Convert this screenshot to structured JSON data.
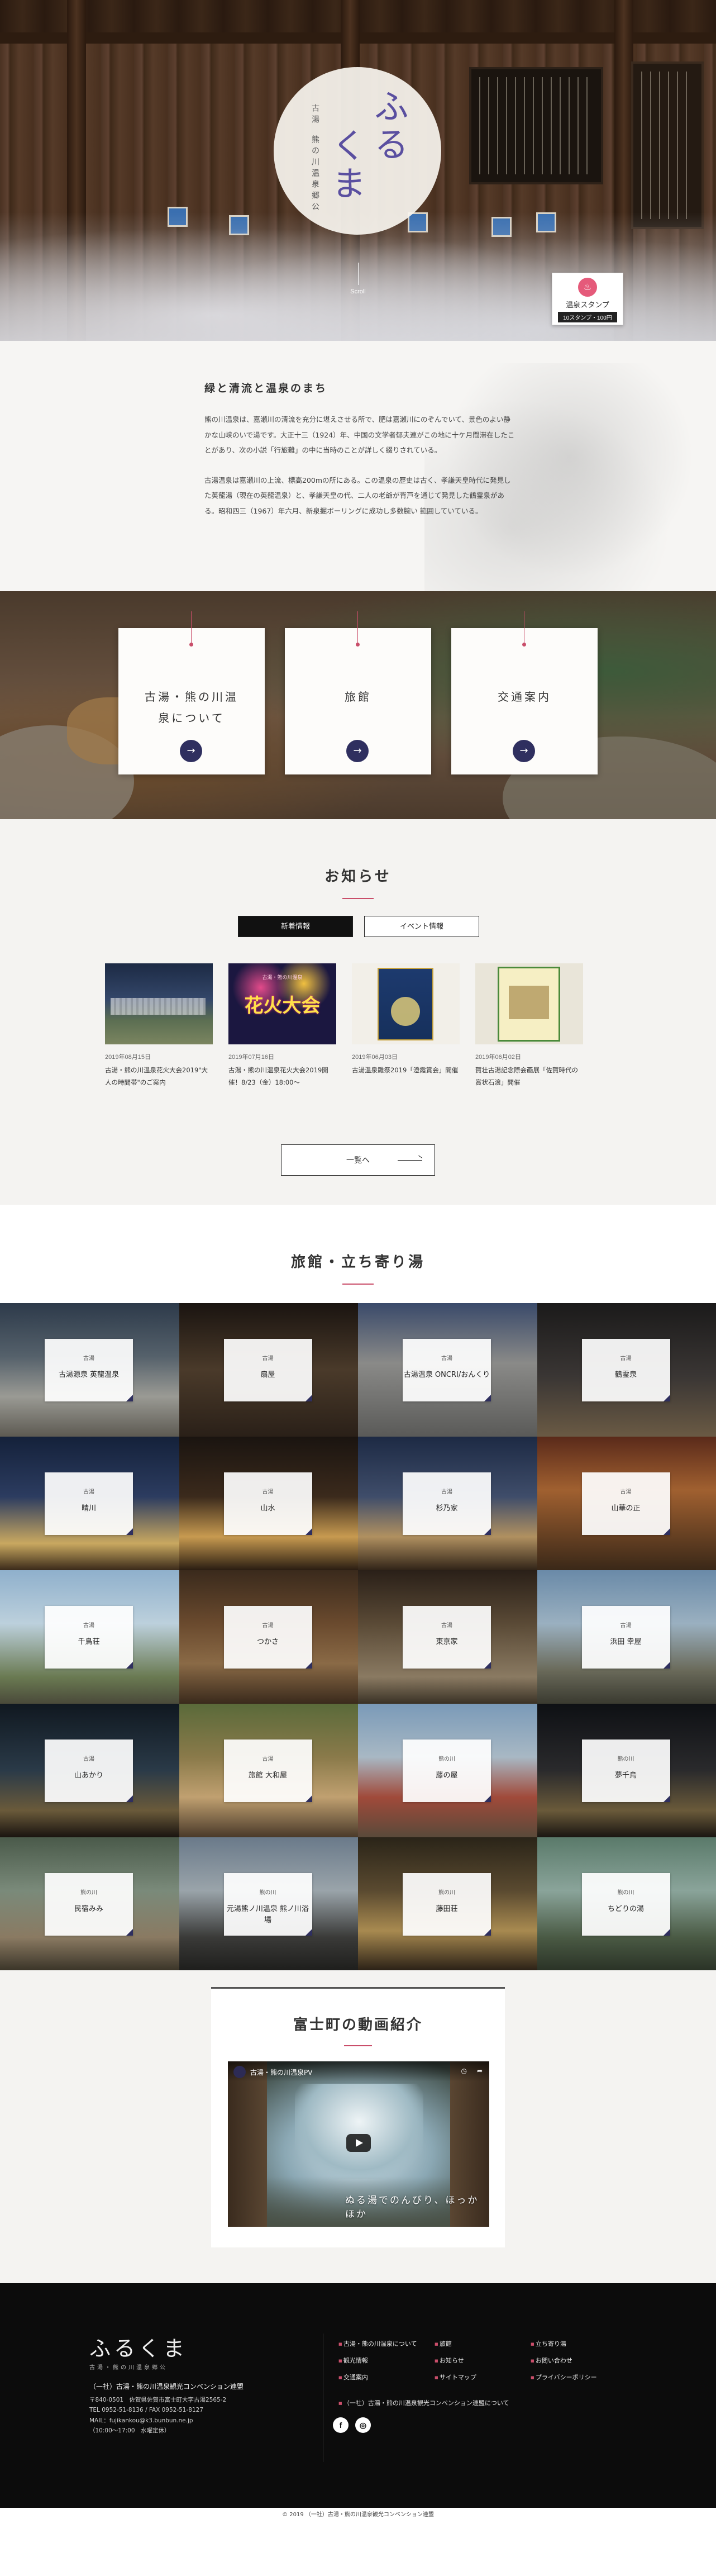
{
  "hero": {
    "logo_main_right": "ふる",
    "logo_main_left": "くま",
    "logo_sub_1": "古湯",
    "logo_sub_2": "熊の川温泉郷公",
    "scroll_label": "Scroll",
    "stamp_title": "温泉スタンプ",
    "stamp_sub": "10スタンプ・100円"
  },
  "intro": {
    "title": "緑と清流と温泉のまち",
    "p1": "熊の川温泉は、嘉瀬川の清流を充分に堪えさせる所で、肥は嘉瀬川にのぞんでいて、景色のよい静かな山峡のいで湯です。大正十三（1924）年、中国の文学者郁夫連がこの地に十ケ月間滞在したことがあり、次の小説「行旅難」の中に当時のことが詳しく綴りされている。",
    "p2": "古湯温泉は嘉瀬川の上流、標高200mの所にある。この温泉の歴史は古く、孝謙天皇時代に発見した英龍湯（現在の英龍温泉）と、孝謙天皇の代、二人の老爺が背戸を通じて発見した鶴霊泉がある。昭和四三（1967）年六月、新泉掘ボーリングに成功し多数腕い 範囲していている。"
  },
  "categories": [
    {
      "title": "古湯・熊の川温泉について",
      "arrow": "→"
    },
    {
      "title": "旅館",
      "arrow": "→"
    },
    {
      "title": "交通案内",
      "arrow": "→"
    }
  ],
  "news": {
    "title": "お知らせ",
    "tabs": [
      "新着情報",
      "イベント情報"
    ],
    "items": [
      {
        "date": "2019年08月15日",
        "text": "古湯・熊の川温泉花火大会2019\"大人の時間帯\"のご案内"
      },
      {
        "date": "2019年07月16日",
        "text": "古湯・熊の川温泉花火大会2019開催！8/23（金）18:00〜"
      },
      {
        "date": "2019年06月03日",
        "text": "古湯温泉雛祭2019「澄霞賞会」開催"
      },
      {
        "date": "2019年06月02日",
        "text": "賀壮古湯記念際会画展「佐賀時代の賞状石浪」開催"
      }
    ],
    "thumb2_caption": "花火大会",
    "thumb2_sub": "古湯・熊の川温泉",
    "more_label": "一覧へ"
  },
  "ryokan": {
    "title": "旅館・立ち寄り湯",
    "items": [
      {
        "area": "古湯",
        "name": "古湯源泉 英龍温泉"
      },
      {
        "area": "古湯",
        "name": "扇屋"
      },
      {
        "area": "古湯",
        "name": "古湯温泉 ONCRI/おんくり"
      },
      {
        "area": "古湯",
        "name": "鶴霊泉"
      },
      {
        "area": "古湯",
        "name": "晴川"
      },
      {
        "area": "古湯",
        "name": "山水"
      },
      {
        "area": "古湯",
        "name": "杉乃家"
      },
      {
        "area": "古湯",
        "name": "山華の正"
      },
      {
        "area": "古湯",
        "name": "千鳥荘"
      },
      {
        "area": "古湯",
        "name": "つかさ"
      },
      {
        "area": "古湯",
        "name": "東京家"
      },
      {
        "area": "古湯",
        "name": "浜田 幸屋"
      },
      {
        "area": "古湯",
        "name": "山あかり"
      },
      {
        "area": "古湯",
        "name": "旅館 大和屋"
      },
      {
        "area": "熊の川",
        "name": "藤の屋"
      },
      {
        "area": "熊の川",
        "name": "夢千鳥"
      },
      {
        "area": "熊の川",
        "name": "民宿みみ"
      },
      {
        "area": "熊の川",
        "name": "元湯熊ノ川温泉 熊ノ川浴場"
      },
      {
        "area": "熊の川",
        "name": "藤田荘"
      },
      {
        "area": "熊の川",
        "name": "ちどりの湯"
      }
    ]
  },
  "video": {
    "title": "富士町の動画紹介",
    "video_name": "古湯・熊の川温泉PV",
    "caption": "ぬる湯でのんびり、ほっかほか"
  },
  "footer": {
    "logo": "ふるくま",
    "logo_sub": "古湯・熊の川温泉郷公",
    "org": "（一社）古湯・熊の川温泉観光コンベンション連盟",
    "addr1": "〒840-0501　佐賀県佐賀市富士町大字古湯2565-2",
    "addr2": "TEL 0952-51-8136 / FAX 0952-51-8127",
    "addr3": "MAIL：fujikankou@k3.bunbun.ne.jp",
    "addr4": "（10:00〜17:00　水曜定休）",
    "nav": [
      "古湯・熊の川温泉について",
      "旅館",
      "立ち寄り湯",
      "観光情報",
      "お知らせ",
      "お問い合わせ",
      "交通案内",
      "サイトマップ",
      "プライバシーポリシー"
    ],
    "nav_wide": "（一社）古湯・熊の川温泉観光コンベンション連盟について",
    "social_f": "f",
    "social_i": "◎",
    "copyright": "© 2019 （一社）古湯・熊の川温泉観光コンベンション連盟"
  },
  "colors": {
    "accent": "#c94e6a",
    "navy": "#2f2f5f",
    "dark": "#0c0c0c"
  }
}
